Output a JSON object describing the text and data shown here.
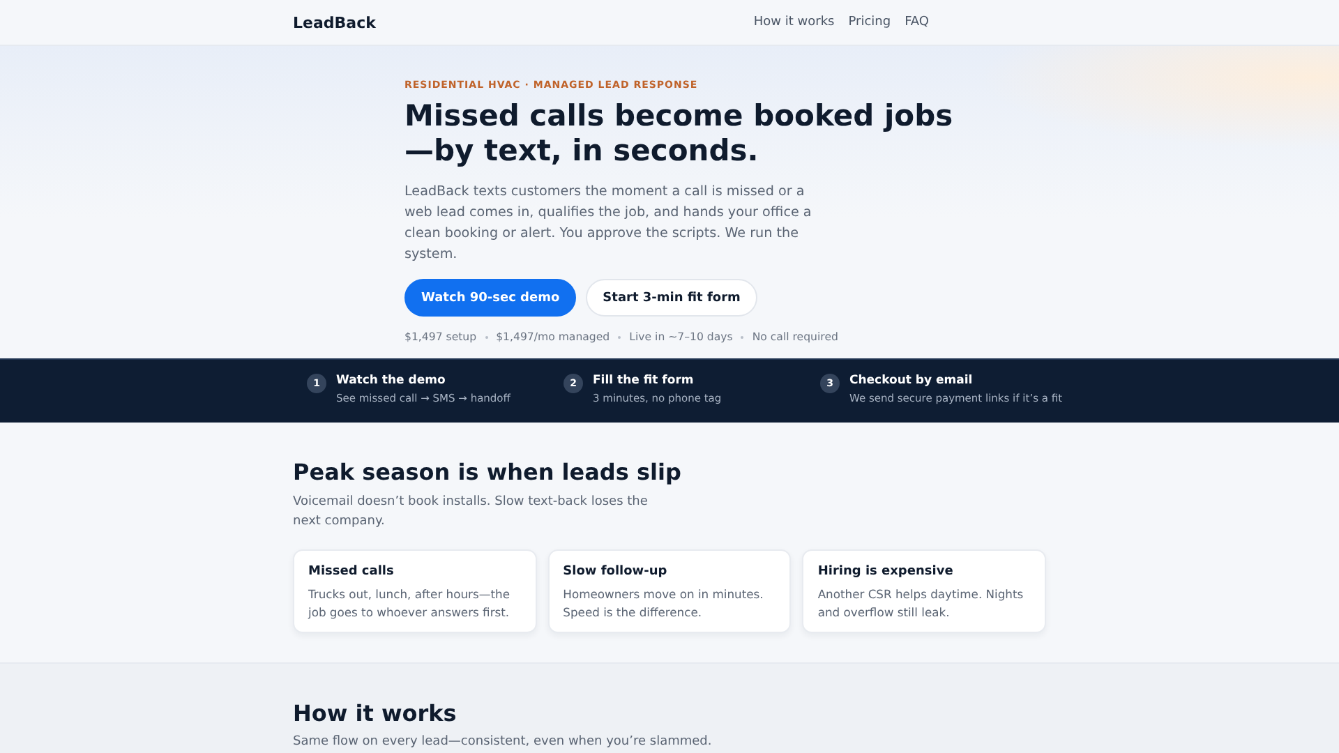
{
  "header": {
    "logo": "LeadBack",
    "nav": [
      "How it works",
      "Pricing",
      "FAQ"
    ]
  },
  "hero": {
    "eyebrow": "RESIDENTIAL HVAC · MANAGED LEAD RESPONSE",
    "title": "Missed calls become booked jobs —by text, in seconds.",
    "lead": "LeadBack texts customers the moment a call is missed or a web lead comes in, qualifies the job, and hands your office a clean booking or alert. You approve the scripts. We run the system.",
    "buttons": [
      {
        "label": "Watch 90-sec demo",
        "kind": "primary"
      },
      {
        "label": "Start 3-min fit form",
        "kind": "secondary"
      }
    ],
    "facts": [
      "$1,497 setup",
      "$1,497/mo managed",
      "Live in ~7–10 days",
      "No call required"
    ]
  },
  "steps": [
    {
      "number": "1",
      "title": "Watch the demo",
      "text": "See missed call → SMS → handoff"
    },
    {
      "number": "2",
      "title": "Fill the fit form",
      "text": "3 minutes, no phone tag"
    },
    {
      "number": "3",
      "title": "Checkout by email",
      "text": "We send secure payment links if it’s a fit"
    }
  ],
  "problem": {
    "title": "Peak season is when leads slip",
    "subtitle": "Voicemail doesn’t book installs. Slow text-back loses the next company.",
    "cards": [
      {
        "title": "Missed calls",
        "text": "Trucks out, lunch, after hours—the job goes to whoever answers first."
      },
      {
        "title": "Slow follow-up",
        "text": "Homeowners move on in minutes. Speed is the difference."
      },
      {
        "title": "Hiring is expensive",
        "text": "Another CSR helps daytime. Nights and overflow still leak."
      }
    ]
  },
  "how": {
    "title": "How it works",
    "subtitle": "Same flow on every lead—consistent, even when you’re slammed."
  }
}
